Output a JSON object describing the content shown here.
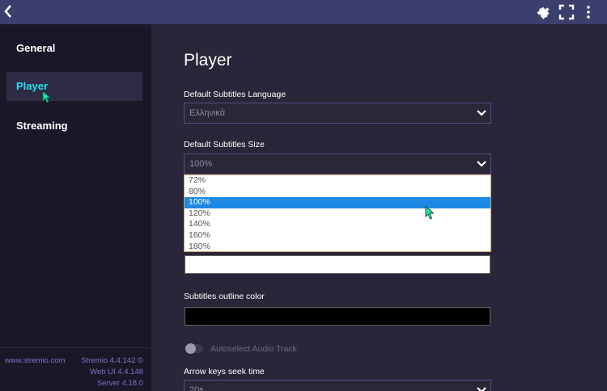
{
  "topbar": {
    "back_icon": "back-arrow-icon",
    "addon_icon": "puzzle-icon",
    "fullscreen_icon": "fullscreen-icon",
    "menu_icon": "kebab-menu-icon"
  },
  "sidebar": {
    "items": [
      {
        "label": "General"
      },
      {
        "label": "Player",
        "active": true
      },
      {
        "label": "Streaming"
      }
    ],
    "footer": {
      "link": "www.stremio.com",
      "app_version": "Stremio 4.4.142 ©",
      "web_ui": "Web UI 4.4.148",
      "server": "Server 4.18.0"
    }
  },
  "main": {
    "title": "Player",
    "subtitles_language": {
      "label": "Default Subtitles Language",
      "value": "Ελληνικά"
    },
    "subtitles_size": {
      "label": "Default Subtitles Size",
      "value": "100%",
      "options": [
        "72%",
        "80%",
        "100%",
        "120%",
        "140%",
        "160%",
        "180%"
      ],
      "selected": "100%"
    },
    "text_color": {
      "value": "#ffffff"
    },
    "outline_color": {
      "label": "Subtitles outline color",
      "value": "#000000"
    },
    "autoselect_audio": {
      "label": "Autoselect Audio Track",
      "enabled": false
    },
    "seek_time": {
      "label": "Arrow keys seek time",
      "value": "20s"
    }
  },
  "colors": {
    "accent": "#1ee0f0",
    "highlight": "#1e88e5",
    "topbar": "#3a3f6e",
    "link": "#7a73c8"
  }
}
